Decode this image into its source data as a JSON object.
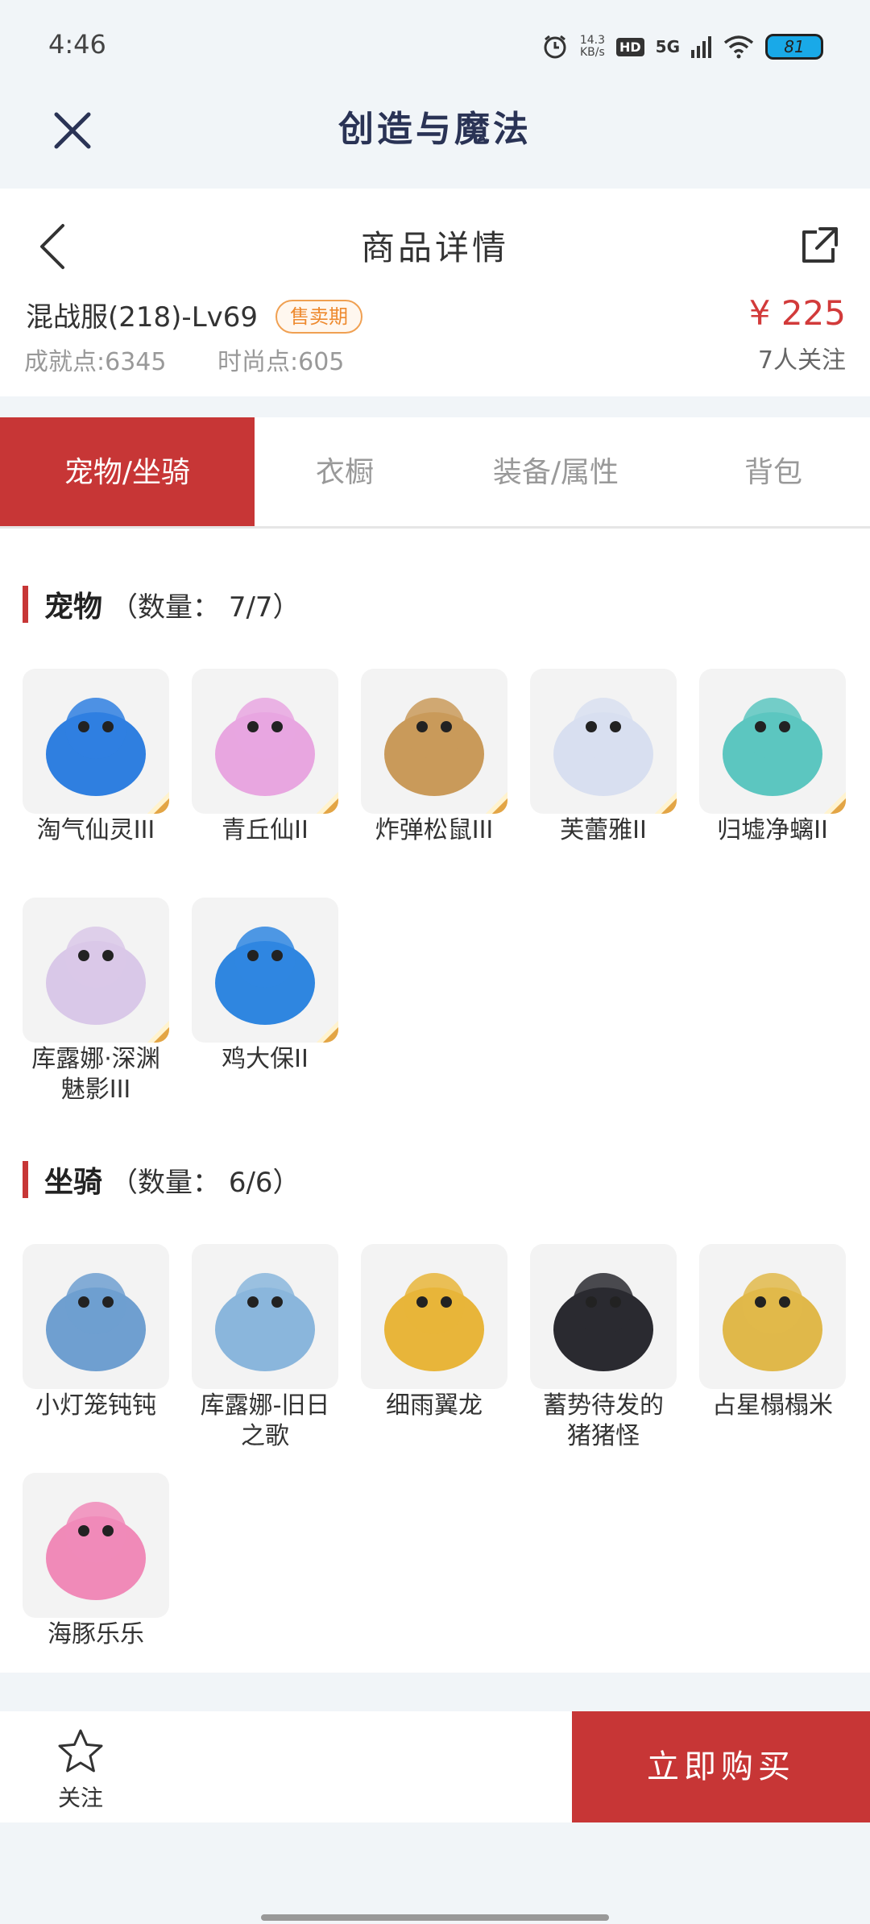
{
  "status": {
    "time": "4:46",
    "net_speed_value": "14.3",
    "net_speed_unit": "KB/s",
    "hd": "HD",
    "signal": "5G",
    "battery": "81"
  },
  "app": {
    "title": "创造与魔法"
  },
  "product": {
    "page_title": "商品详情",
    "server_name": "混战服(218)-Lv69",
    "badge": "售卖期",
    "achievement": "成就点:6345",
    "fashion": "时尚点:605",
    "price": "¥ 225",
    "followers": "7人关注"
  },
  "tabs": [
    {
      "label": "宠物/坐骑"
    },
    {
      "label": "衣橱"
    },
    {
      "label": "装备/属性"
    },
    {
      "label": "背包"
    }
  ],
  "pets": {
    "title": "宠物",
    "count": "（数量： 7/7）",
    "items": [
      {
        "name": "淘气仙灵III",
        "grade": "III",
        "icon": "blue-puppy-icon",
        "color": "#2f7fe0"
      },
      {
        "name": "青丘仙II",
        "grade": "II",
        "icon": "fox-fairy-icon",
        "color": "#e8a6e0"
      },
      {
        "name": "炸弹松鼠III",
        "grade": "III",
        "icon": "squirrel-icon",
        "color": "#c99a5a"
      },
      {
        "name": "芙蕾雅II",
        "grade": "II",
        "icon": "valkyrie-icon",
        "color": "#d8dff0"
      },
      {
        "name": "归墟净螭II",
        "grade": "II",
        "icon": "jade-dragon-icon",
        "color": "#5cc6c0"
      },
      {
        "name": "库露娜·深渊魅影III",
        "grade": "III",
        "icon": "abyss-girl-icon",
        "color": "#d9c8e8"
      },
      {
        "name": "鸡大保II",
        "grade": "II",
        "icon": "blue-bird-icon",
        "color": "#2f86e0"
      }
    ]
  },
  "mounts": {
    "title": "坐骑",
    "count": "（数量： 6/6）",
    "items": [
      {
        "name": "小灯笼钝钝",
        "icon": "lantern-frog-icon",
        "color": "#6f9fd0"
      },
      {
        "name": "库露娜-旧日之歌",
        "icon": "cloud-girl-icon",
        "color": "#8ab6dc"
      },
      {
        "name": "细雨翼龙",
        "icon": "pterosaur-icon",
        "color": "#e8b53a"
      },
      {
        "name": "蓄势待发的猪猪怪",
        "icon": "black-pig-icon",
        "color": "#2a2a30"
      },
      {
        "name": "占星榻榻米",
        "icon": "crystal-dome-icon",
        "color": "#e0b84a"
      },
      {
        "name": "海豚乐乐",
        "icon": "pink-dolphin-icon",
        "color": "#f08ab8"
      }
    ]
  },
  "bottom": {
    "follow": "关注",
    "buy": "立即购买"
  },
  "colors": {
    "accent": "#c73636",
    "badge": "#ee8a2f",
    "price": "#d23a3a"
  }
}
